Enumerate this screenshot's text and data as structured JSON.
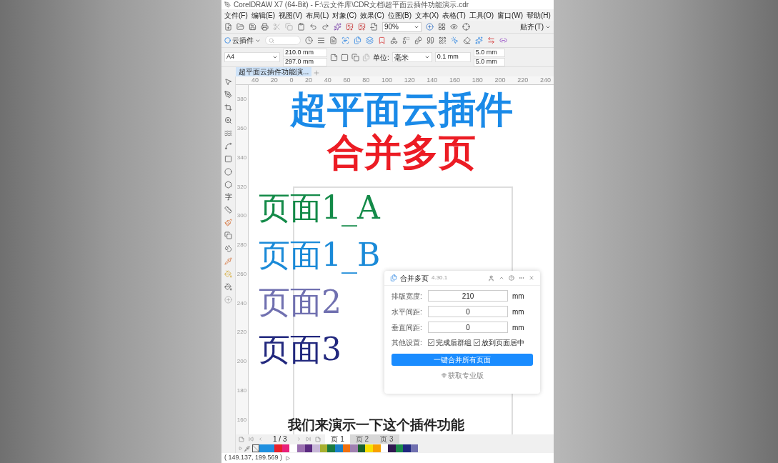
{
  "window": {
    "title": "CorelDRAW X7 (64-Bit) - F:\\云文件库\\CDR文档\\超平面云插件功能演示.cdr"
  },
  "menu": [
    "文件(F)",
    "编辑(E)",
    "视图(V)",
    "布局(L)",
    "对象(C)",
    "效果(C)",
    "位图(B)",
    "文本(X)",
    "表格(T)",
    "工具(O)",
    "窗口(W)",
    "帮助(H)"
  ],
  "standard_toolbar": {
    "zoom": "90%",
    "snap": "贴齐(T)"
  },
  "plugin_toolbar": {
    "label": "云插件"
  },
  "property_bar": {
    "page_size": "A4",
    "width": "210.0 mm",
    "height": "297.0 mm",
    "units_label": "单位:",
    "units": "毫米",
    "nudge": "0.1 mm",
    "dup_x": "5.0 mm",
    "dup_y": "5.0 mm"
  },
  "document_tab": {
    "label": "超平面云插件功能演..."
  },
  "toolbox": {
    "text_tool": "字"
  },
  "h_ruler": [
    "40",
    "20",
    "0",
    "20",
    "40",
    "60",
    "80",
    "100",
    "120",
    "140",
    "160",
    "180",
    "200",
    "220",
    "240"
  ],
  "v_ruler": [
    "380",
    "360",
    "340",
    "320",
    "300",
    "280",
    "260",
    "240",
    "220",
    "200",
    "180",
    "160"
  ],
  "canvas": {
    "headlines": [
      {
        "text": "超平面云插件",
        "color": "#1a8ae8"
      },
      {
        "text": "合并多页",
        "color": "#ec1c24"
      }
    ],
    "page_labels": [
      {
        "text": "页面1_A",
        "color": "#138a48"
      },
      {
        "text": "页面1_B",
        "color": "#1a8ad8"
      },
      {
        "text": "页面2",
        "color": "#7070b0"
      },
      {
        "text": "页面3",
        "color": "#22287e"
      }
    ],
    "caption": "我们来演示一下这个插件功能"
  },
  "dialog": {
    "title": "合并多页",
    "version": "4.30.1",
    "fields": [
      {
        "label": "排版宽度:",
        "value": "210",
        "unit": "mm"
      },
      {
        "label": "水平间距:",
        "value": "0",
        "unit": "mm"
      },
      {
        "label": "垂直间距:",
        "value": "0",
        "unit": "mm"
      }
    ],
    "options_label": "其他设置:",
    "options": [
      {
        "label": "完成后群组",
        "checked": true
      },
      {
        "label": "放到页面居中",
        "checked": true
      }
    ],
    "button": "一键合并所有页面",
    "link": "获取专业版"
  },
  "page_nav": {
    "counter": "1 / 3",
    "pages": [
      {
        "label": "页 1",
        "selected": true
      },
      {
        "label": "页 2",
        "selected": false
      },
      {
        "label": "页 3",
        "selected": false
      }
    ]
  },
  "palette": [
    {
      "color": "#1e90e0"
    },
    {
      "color": "#1e90e0"
    },
    {
      "color": "#e8202a"
    },
    {
      "color": "#e8207a"
    },
    {
      "color": "#ffffff"
    },
    {
      "color": "#9a70b0"
    },
    {
      "color": "#5a2a80"
    },
    {
      "color": "#c8b8d8"
    },
    {
      "color": "#a8b030"
    },
    {
      "color": "#1a7a40"
    },
    {
      "color": "#1a80c8"
    },
    {
      "color": "#f07010"
    },
    {
      "color": "#a080b0"
    },
    {
      "color": "#1a6030"
    },
    {
      "color": "#f8e000"
    },
    {
      "color": "#f8a000"
    },
    {
      "color": "#ffffff"
    },
    {
      "color": "#301850"
    },
    {
      "color": "#1a8a4a"
    },
    {
      "color": "#202880"
    },
    {
      "color": "#7070b0"
    }
  ],
  "status_bar": {
    "coordinates": "( 149.137, 199.569 )"
  }
}
